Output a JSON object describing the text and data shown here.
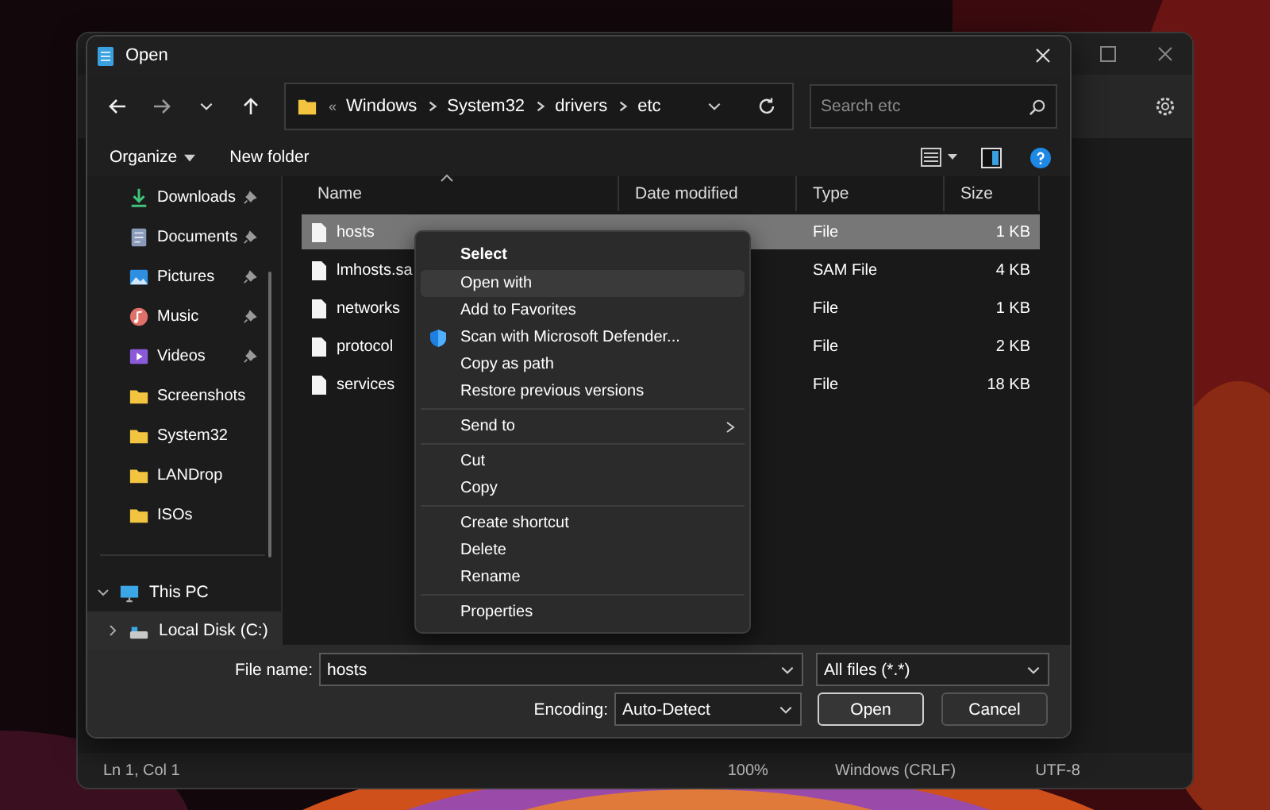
{
  "notepad": {
    "status_bar": [
      "Ln 1, Col 1",
      "100%",
      "Windows (CRLF)",
      "UTF-8"
    ]
  },
  "dialog": {
    "title": "Open",
    "address": {
      "overflow": "«",
      "parts": [
        "Windows",
        "System32",
        "drivers",
        "etc"
      ]
    },
    "search": {
      "placeholder": "Search etc"
    },
    "toolbar": {
      "organize": "Organize",
      "new_folder": "New folder"
    },
    "sidebar": {
      "items": [
        {
          "label": "Downloads",
          "kind": "downloads",
          "pinned": true
        },
        {
          "label": "Documents",
          "kind": "documents",
          "pinned": true
        },
        {
          "label": "Pictures",
          "kind": "pictures",
          "pinned": true
        },
        {
          "label": "Music",
          "kind": "music",
          "pinned": true
        },
        {
          "label": "Videos",
          "kind": "videos",
          "pinned": true
        },
        {
          "label": "Screenshots",
          "kind": "folder",
          "pinned": false
        },
        {
          "label": "System32",
          "kind": "folder",
          "pinned": false
        },
        {
          "label": "LANDrop",
          "kind": "folder",
          "pinned": false
        },
        {
          "label": "ISOs",
          "kind": "folder",
          "pinned": false
        }
      ],
      "tree": [
        {
          "label": "This PC",
          "kind": "pc",
          "expanded": true,
          "selected": false,
          "children": [
            {
              "label": "Local Disk (C:)",
              "kind": "disk",
              "expanded": false,
              "selected": true
            }
          ]
        }
      ]
    },
    "columns": [
      "Name",
      "Date modified",
      "Type",
      "Size"
    ],
    "files": [
      {
        "name": "hosts",
        "type": "File",
        "size": "1 KB",
        "selected": true
      },
      {
        "name": "lmhosts.sa",
        "type": "SAM File",
        "size": "4 KB",
        "selected": false
      },
      {
        "name": "networks",
        "type": "File",
        "size": "1 KB",
        "selected": false
      },
      {
        "name": "protocol",
        "type": "File",
        "size": "2 KB",
        "selected": false
      },
      {
        "name": "services",
        "type": "File",
        "size": "18 KB",
        "selected": false
      }
    ],
    "context_menu": {
      "groups": [
        [
          {
            "label": "Select",
            "kind": "default",
            "selected": false
          },
          {
            "label": "Open with",
            "kind": "item",
            "selected": true
          },
          {
            "label": "Add to Favorites",
            "kind": "item",
            "selected": false
          },
          {
            "label": "Scan with Microsoft Defender...",
            "kind": "defender",
            "selected": false
          },
          {
            "label": "Copy as path",
            "kind": "item",
            "selected": false
          },
          {
            "label": "Restore previous versions",
            "kind": "item",
            "selected": false
          }
        ],
        [
          {
            "label": "Send to",
            "kind": "submenu",
            "selected": false
          }
        ],
        [
          {
            "label": "Cut",
            "kind": "item",
            "selected": false
          },
          {
            "label": "Copy",
            "kind": "item",
            "selected": false
          }
        ],
        [
          {
            "label": "Create shortcut",
            "kind": "item",
            "selected": false
          },
          {
            "label": "Delete",
            "kind": "item",
            "selected": false
          },
          {
            "label": "Rename",
            "kind": "item",
            "selected": false
          }
        ],
        [
          {
            "label": "Properties",
            "kind": "item",
            "selected": false
          }
        ]
      ]
    },
    "file_name": {
      "label": "File name:",
      "value": "hosts"
    },
    "file_type": {
      "value": "All files  (*.*)"
    },
    "encoding": {
      "label": "Encoding:",
      "value": "Auto-Detect"
    },
    "buttons": [
      {
        "label": "Open",
        "kind": "primary"
      },
      {
        "label": "Cancel",
        "kind": "secondary"
      }
    ]
  }
}
